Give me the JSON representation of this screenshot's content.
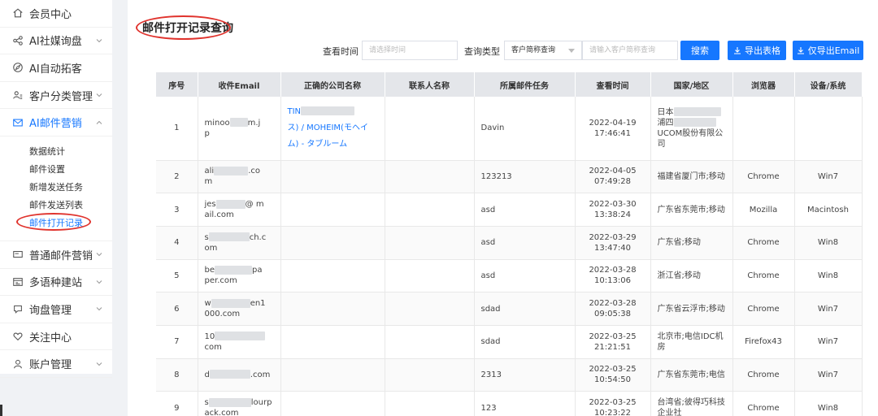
{
  "sidebar": {
    "items": [
      {
        "label": "会员中心",
        "icon": "home-icon",
        "chevron": false
      },
      {
        "label": "AI社媒询盘",
        "icon": "share-icon",
        "chevron": true
      },
      {
        "label": "AI自动拓客",
        "icon": "compass-icon",
        "chevron": false
      },
      {
        "label": "客户分类管理",
        "icon": "users-icon",
        "chevron": true
      },
      {
        "label": "AI邮件营销",
        "icon": "mail-icon",
        "chevron": true,
        "expanded": true
      }
    ],
    "submenu": [
      {
        "label": "数据统计"
      },
      {
        "label": "邮件设置"
      },
      {
        "label": "新增发送任务"
      },
      {
        "label": "邮件发送列表"
      },
      {
        "label": "邮件打开记录",
        "active": true
      }
    ],
    "items_after": [
      {
        "label": "普通邮件营销",
        "icon": "envelope-icon",
        "chevron": true
      },
      {
        "label": "多语种建站",
        "icon": "website-icon",
        "chevron": true
      },
      {
        "label": "询盘管理",
        "icon": "chat-icon",
        "chevron": true
      },
      {
        "label": "关注中心",
        "icon": "heart-icon",
        "chevron": false
      },
      {
        "label": "账户管理",
        "icon": "user-icon",
        "chevron": true
      }
    ]
  },
  "page": {
    "title": "邮件打开记录查询"
  },
  "filters": {
    "time_label": "查看时间",
    "time_placeholder": "请选择时间",
    "type_label": "查询类型",
    "type_value": "客户简称查询",
    "keyword_placeholder": "请输入客户简称查询",
    "search_label": "搜索",
    "export_label": "导出表格",
    "export_email_label": "仅导出Email"
  },
  "table": {
    "columns": [
      "序号",
      "收件Email",
      "正确的公司名称",
      "联系人名称",
      "所属邮件任务",
      "查看时间",
      "国家/地区",
      "浏览器",
      "设备/系统"
    ],
    "rows": [
      {
        "no": "1",
        "email_a": "minoo",
        "email_b": "m.j",
        "email_c": "p",
        "company_a": "TIN",
        "company_b": "ス) / MOHEIM(モヘイ",
        "company_c": "ム) - タブルーム",
        "contact": "",
        "task": "Davin",
        "date": "2022-04-19",
        "time": "17:46:41",
        "region_a": "日本",
        "region_b": "浦四",
        "region_c": "UCOM股份有限公",
        "region_d": "司",
        "browser": "",
        "device": ""
      },
      {
        "no": "2",
        "email_a": "ali",
        "email_b": ".co",
        "email_c": "m",
        "task": "123213",
        "date": "2022-04-05",
        "time": "07:49:28",
        "region": "福建省厦门市;移动",
        "browser": "Chrome",
        "device": "Win7"
      },
      {
        "no": "3",
        "email_a": "jes",
        "email_b": "@ m",
        "email_c": "ail.com",
        "task": "asd",
        "date": "2022-03-30",
        "time": "13:38:24",
        "region": "广东省东莞市;移动",
        "browser": "Mozilla",
        "device": "Macintosh"
      },
      {
        "no": "4",
        "email_a": "s",
        "email_b": "ch.c",
        "email_c": "om",
        "task": "asd",
        "date": "2022-03-29",
        "time": "13:47:40",
        "region": "广东省;移动",
        "browser": "Chrome",
        "device": "Win8"
      },
      {
        "no": "5",
        "email_a": "be",
        "email_b": "pa",
        "email_c": "per.com",
        "task": "asd",
        "date": "2022-03-28",
        "time": "10:13:06",
        "region": "浙江省;移动",
        "browser": "Chrome",
        "device": "Win8"
      },
      {
        "no": "6",
        "email_a": "w",
        "email_b": "en1",
        "email_c": "000.com",
        "task": "sdad",
        "date": "2022-03-28",
        "time": "09:05:38",
        "region": "广东省云浮市;移动",
        "browser": "Chrome",
        "device": "Win7"
      },
      {
        "no": "7",
        "email_a": "10",
        "email_b": "",
        "email_c": "com",
        "task": "sdad",
        "date": "2022-03-25",
        "time": "21:21:51",
        "region_a": "北京市;电信IDC机",
        "region_b": "房",
        "browser": "Firefox43",
        "device": "Win7"
      },
      {
        "no": "8",
        "email_a": "d",
        "email_b": ".com",
        "email_c": "",
        "task": "2313",
        "date": "2022-03-25",
        "time": "10:54:50",
        "region": "广东省东莞市;电信",
        "browser": "Chrome",
        "device": "Win7"
      },
      {
        "no": "9",
        "email_a": "s",
        "email_b": "lourp",
        "email_c": "ack.com",
        "task": "123",
        "date": "2022-03-25",
        "time": "10:23:22",
        "region_a": "台湾省;彼得巧科技",
        "region_b": "企业社",
        "browser": "Chrome",
        "device": "Win8"
      }
    ]
  }
}
